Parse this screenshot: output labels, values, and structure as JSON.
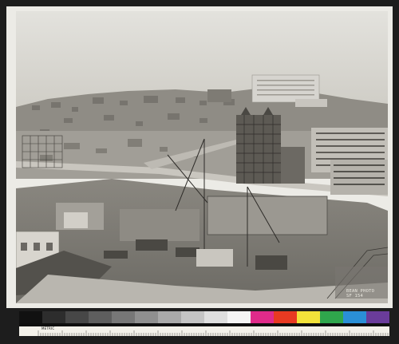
{
  "photo": {
    "credit_line_1": "BEAN PHOTO",
    "credit_line_2": "SF 154"
  },
  "color_target": {
    "swatch_colors": [
      "#111111",
      "#2d2d2d",
      "#474747",
      "#5e5e5e",
      "#777777",
      "#8f8f8f",
      "#a9a9a9",
      "#c4c4c4",
      "#dedede",
      "#f4f4f4",
      "#e02b8a",
      "#e83a22",
      "#f2e23a",
      "#2fa64c",
      "#2a8fd6",
      "#6a3c9a"
    ],
    "ruler_label": "METRIC"
  }
}
